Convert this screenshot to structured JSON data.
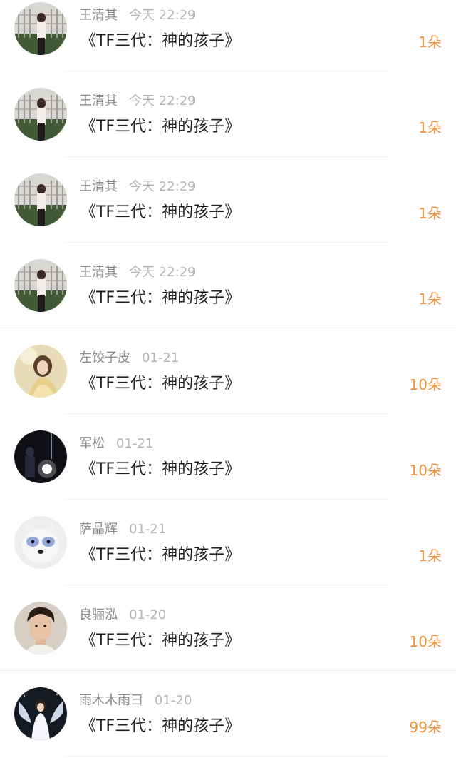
{
  "comments": [
    {
      "username": "王清其",
      "time": "今天 22:29",
      "title": "《TF三代：神的孩子》",
      "flowers": "1朵",
      "avatar_icon": "avatar-photo-icon"
    },
    {
      "username": "王清其",
      "time": "今天 22:29",
      "title": "《TF三代：神的孩子》",
      "flowers": "1朵",
      "avatar_icon": "avatar-photo-icon"
    },
    {
      "username": "王清其",
      "time": "今天 22:29",
      "title": "《TF三代：神的孩子》",
      "flowers": "1朵",
      "avatar_icon": "avatar-photo-icon"
    },
    {
      "username": "王清其",
      "time": "今天 22:29",
      "title": "《TF三代：神的孩子》",
      "flowers": "1朵",
      "avatar_icon": "avatar-photo-icon"
    },
    {
      "username": "左饺子皮",
      "time": "01-21",
      "title": "《TF三代：神的孩子》",
      "flowers": "10朵",
      "avatar_icon": "avatar-photo-icon"
    },
    {
      "username": "军松",
      "time": "01-21",
      "title": "《TF三代：神的孩子》",
      "flowers": "10朵",
      "avatar_icon": "avatar-photo-icon"
    },
    {
      "username": "萨晶辉",
      "time": "01-21",
      "title": "《TF三代：神的孩子》",
      "flowers": "1朵",
      "avatar_icon": "avatar-photo-icon"
    },
    {
      "username": "良骊泓",
      "time": "01-20",
      "title": "《TF三代：神的孩子》",
      "flowers": "10朵",
      "avatar_icon": "avatar-photo-icon"
    },
    {
      "username": "雨木木雨彐",
      "time": "01-20",
      "title": "《TF三代：神的孩子》",
      "flowers": "99朵",
      "avatar_icon": "avatar-photo-icon"
    }
  ],
  "colors": {
    "flower_accent": "#f2903a",
    "username": "#8a8a8a",
    "time": "#b3b3b3",
    "title": "#1f1f1f"
  }
}
